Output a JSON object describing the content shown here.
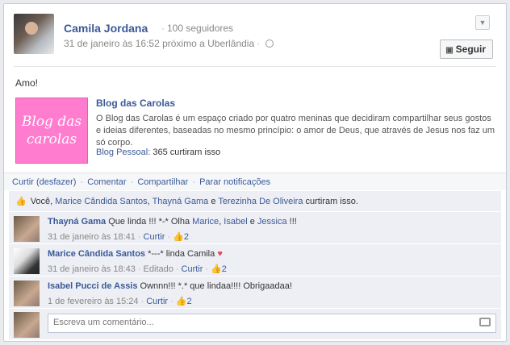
{
  "post": {
    "author": "Camila Jordana",
    "followers": "100 seguidores",
    "timestamp": "31 de janeiro às 16:52 próximo a Uberlândia",
    "follow_label": "Seguir",
    "text": "Amo!"
  },
  "link": {
    "thumb_line1": "Blog das",
    "thumb_line2": "carolas",
    "title": "Blog das Carolas",
    "description": "O Blog das Carolas é um espaço criado por quatro meninas que decidiram compartilhar seus gostos e ideias diferentes, baseadas no mesmo princípio: o amor de Deus, que através de Jesus nos faz um só corpo.",
    "source_label": "Blog Pessoal:",
    "source_count": "365 curtiram isso"
  },
  "actions": [
    "Curtir (desfazer)",
    "Comentar",
    "Compartilhar",
    "Parar notificações"
  ],
  "likes": {
    "prefix": "Você,",
    "names": [
      "Marice Cândida Santos",
      "Thayná Gama",
      "Terezinha De Oliveira"
    ],
    "connector": "e",
    "suffix": "curtiram isso."
  },
  "comments": [
    {
      "name": "Thayná Gama",
      "text_a": "Que linda !!! *-* Olha",
      "mention1": "Marice",
      "mention2": "Isabel",
      "connector": "e",
      "mention3": "Jessica",
      "text_b": "!!!",
      "date": "31 de janeiro às 18:41",
      "like": "Curtir",
      "likes": "2"
    },
    {
      "name": "Marice Cândida Santos",
      "text": "*---* linda Camila",
      "heart": "♥",
      "date": "31 de janeiro às 18:43",
      "edited": "Editado",
      "like": "Curtir",
      "likes": "2"
    },
    {
      "name": "Isabel Pucci de Assis",
      "text": "Ownnn!!! *.* que lindaa!!!! Obrigaadaa!",
      "date": "1 de fevereiro às 15:24",
      "like": "Curtir",
      "likes": "2"
    }
  ],
  "write": {
    "placeholder": "Escreva um comentário..."
  },
  "icons": {
    "globe": "globe-icon",
    "thumb": "thumbs-up-icon",
    "camera": "camera-icon",
    "chevron": "chevron-down-icon"
  },
  "colors": {
    "link": "#3b5998",
    "thumb_bg": "#ff7ccf"
  }
}
